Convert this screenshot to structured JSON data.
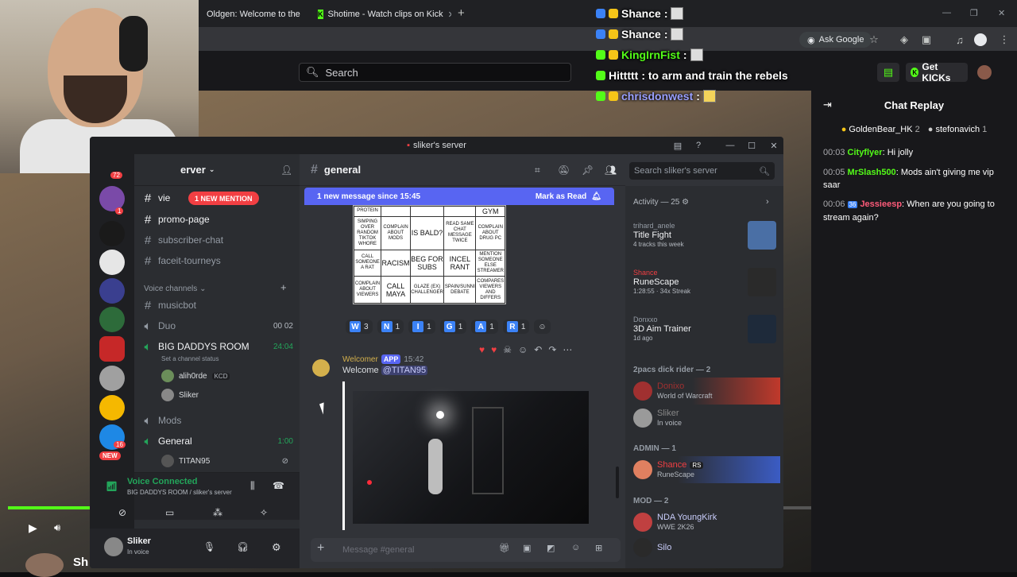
{
  "browser": {
    "tabs": [
      {
        "label": "Oldgen: Welcome to the"
      },
      {
        "label": "Shotime - Watch clips on Kick"
      }
    ],
    "ask_google": "Ask Google"
  },
  "kick": {
    "search_placeholder": "Search",
    "get_kicks": "Get KICKs"
  },
  "overlay_chat": [
    {
      "name": "Shance",
      "text": ":"
    },
    {
      "name": "Shance",
      "text": ":"
    },
    {
      "name": "KingIrnFist",
      "text": ":"
    },
    {
      "name": "Hittttt",
      "text": ": to arm and train the rebels"
    },
    {
      "name": "chrisdonwest",
      "text": ":"
    }
  ],
  "chat_replay": {
    "title": "Chat Replay",
    "gifters": [
      {
        "name": "GoldenBear_HK",
        "count": "2"
      },
      {
        "name": "stefonavich",
        "count": "1"
      }
    ],
    "messages": [
      {
        "time": "00:03",
        "user": "Cityflyer",
        "color": "#53fc18",
        "text": "Hi jolly"
      },
      {
        "time": "00:05",
        "user": "MrSlash500",
        "color": "#53fc18",
        "text": "Mods ain't giving me vip saar"
      },
      {
        "time": "00:06",
        "user": "Jessieesp",
        "color": "#ff5b7a",
        "badge": "36",
        "text": "When are you going to stream again?"
      }
    ]
  },
  "discord": {
    "window_title": "sliker's server",
    "server_name": "erver",
    "new_mention": "1 NEW MENTION",
    "channel_partial": "vie",
    "channels": [
      {
        "name": "promo-page",
        "bold": true
      },
      {
        "name": "subscriber-chat",
        "bold": false
      },
      {
        "name": "faceit-tourneys",
        "bold": false
      }
    ],
    "voice_header": "Voice channels",
    "voice": [
      {
        "name": "musicbot",
        "type": "text",
        "right": ""
      },
      {
        "name": "Duo",
        "type": "voice",
        "right": "00 02"
      },
      {
        "name": "BIG DADDYS ROOM",
        "type": "voice-active",
        "right": "24:04"
      }
    ],
    "channel_status": "Set a channel status",
    "voice_users": [
      {
        "name": "alih0rde",
        "tag": "KCD"
      },
      {
        "name": "Sliker",
        "tag": ""
      }
    ],
    "more_channels": [
      {
        "name": "Mods",
        "type": "voice",
        "right": ""
      },
      {
        "name": "General",
        "type": "voice-active",
        "right": "1:00"
      }
    ],
    "general_user": "TITAN95",
    "server_badges": {
      "top": "72",
      "new": "NEW",
      "count1": "1",
      "count16": "16"
    },
    "voice_connected": "Voice Connected",
    "voice_location": "BIG DADDYS ROOM / sliker's server",
    "user": {
      "name": "Sliker",
      "status": "In voice"
    },
    "channel_title": "general",
    "search_placeholder": "Search sliker's server",
    "new_messages": "1 new message since 15:45",
    "mark_read": "Mark as Read",
    "bingo": [
      [
        "PROTEIN",
        "",
        "",
        "",
        "GYM"
      ],
      [
        "SIMPING OVER RANDOM TIKTOK WHORE",
        "COMPLAIN ABOUT MODS",
        "IS BALD?",
        "READ SAME CHAT MESSAGE TWICE",
        "COMPLAIN ABOUT DRUG PC"
      ],
      [
        "CALL SOMEONE A RAT",
        "RACISM",
        "BEG FOR SUBS",
        "INCEL RANT",
        "MENTION SOMEONE ELSE STREAMER"
      ],
      [
        "COMPLAIN ABOUT VIEWERS",
        "CALL MAYA",
        "GLAZE (EX) CHALLENGER",
        "SPAIN/SUNNI DEBATE",
        "COMPARES VIEWERS AND DIFFERS"
      ]
    ],
    "reactions": [
      {
        "letter": "W",
        "count": "3"
      },
      {
        "letter": "N",
        "count": "1"
      },
      {
        "letter": "I",
        "count": "1"
      },
      {
        "letter": "G",
        "count": "1"
      },
      {
        "letter": "A",
        "count": "1"
      },
      {
        "letter": "R",
        "count": "1"
      }
    ],
    "welcome_user": "Welcomer",
    "app_badge": "APP",
    "welcome_time": "15:42",
    "welcome_text": "Welcome",
    "welcome_mention": "@TITAN95",
    "message_placeholder": "Message #general",
    "activity_header": "Activity — 25",
    "activities": [
      {
        "user": "trihard_anele",
        "title": "Title Fight",
        "sub": "4 tracks this week",
        "color": "#4a6fa5"
      },
      {
        "user": "Shance",
        "title": "RuneScape",
        "sub": "1:28:55 · 34x Streak",
        "color": "#2a2a2a"
      },
      {
        "user": "Donxxo",
        "title": "3D Aim Trainer",
        "sub": "1d ago",
        "color": "#1e2a3a"
      }
    ],
    "sections": [
      {
        "title": "2pacs dick rider — 2",
        "members": [
          {
            "name": "Donixo",
            "sub": "World of Warcraft",
            "color": "#a03030"
          },
          {
            "name": "Sliker",
            "sub": "In voice",
            "color": "#888"
          }
        ]
      },
      {
        "title": "ADMIN — 1",
        "members": [
          {
            "name": "Shance",
            "tag": "RS",
            "sub": "RuneScape",
            "color": "#f23f43"
          }
        ]
      },
      {
        "title": "MOD — 2",
        "members": [
          {
            "name": "NDA YoungKirk",
            "sub": "WWE 2K26",
            "color": "#c9cdfb"
          },
          {
            "name": "Silo",
            "sub": "",
            "color": "#c9cdfb"
          }
        ]
      }
    ]
  },
  "player": {
    "channel_short": "Sh",
    "progress": 0.103
  }
}
